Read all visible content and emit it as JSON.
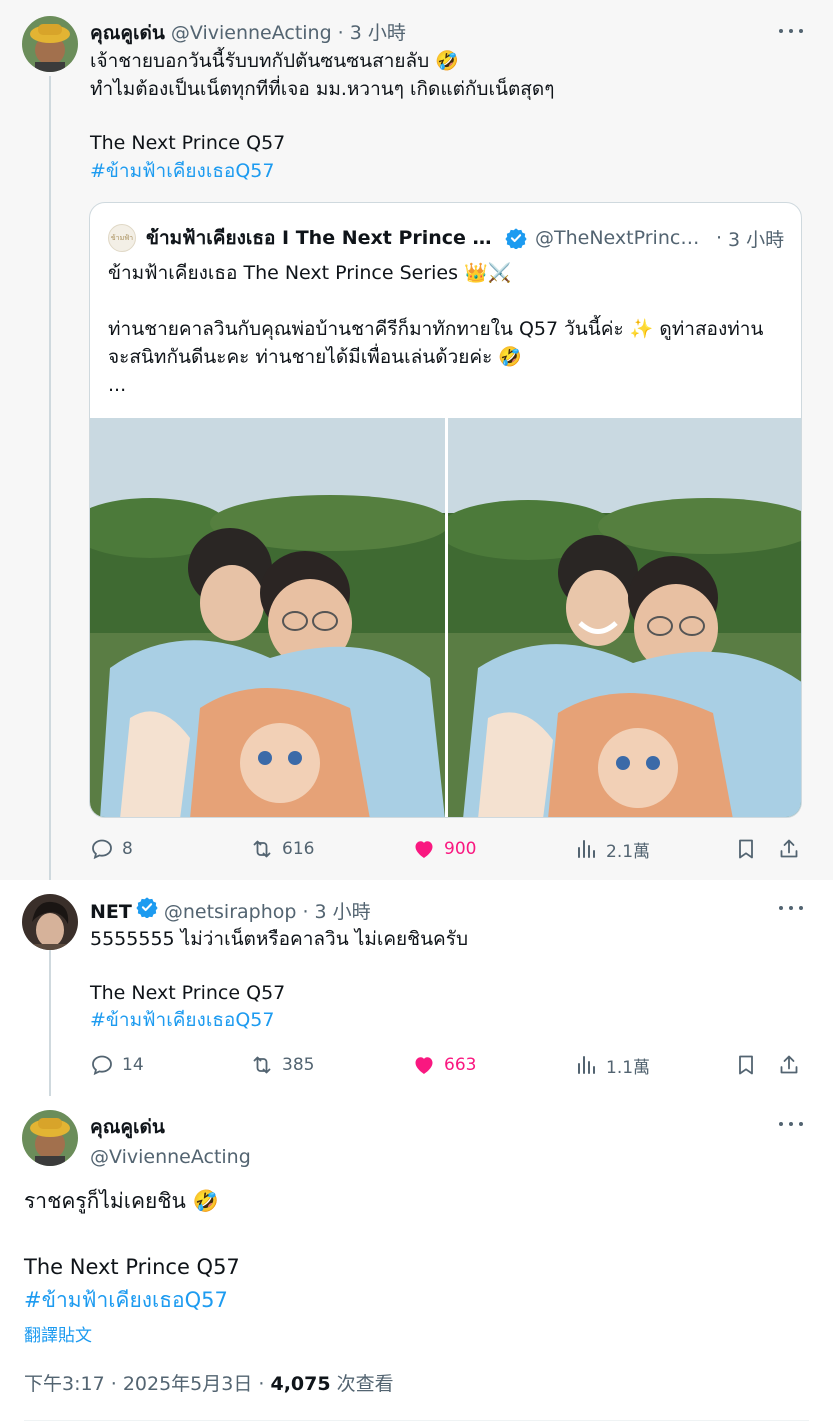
{
  "tweet1": {
    "name": "คุณคูเด่น",
    "handle": "@VivienneActing",
    "separator": "·",
    "time": "3 小時",
    "line1": "เจ้าชายบอกวันนี้รับบทกัปตันซนซนสายลับ 🤣",
    "line2": "ทำไมต้องเป็นเน็ตทุกทีที่เจอ มม.หวานๆ เกิดแต่กับเน็ตสุดๆ",
    "line3": "The Next Prince Q57",
    "hashtag": "#ข้ามฟ้าเคียงเธอQ57",
    "quote": {
      "avatar_text": "ข้ามฟ้า",
      "name": "ข้ามฟ้าเคียงเธอ I The Next Prince Series",
      "handle": "@TheNextPrinceSeries",
      "separator": "·",
      "time": "3 小時",
      "line1": "ข้ามฟ้าเคียงเธอ The Next Prince Series 👑⚔️",
      "line2": "ท่านชายคาลวินกับคุณพ่อบ้านชาคีรีก็มาทักทายใน Q57 วันนี้ค่ะ ✨ ดูท่าสองท่าน",
      "line3": "จะสนิทกันดีนะคะ ท่านชายได้มีเพื่อนเล่นด้วยค่ะ 🤣",
      "line4": "..."
    },
    "replies": "8",
    "reposts": "616",
    "likes": "900",
    "views": "2.1萬"
  },
  "tweet2": {
    "name": "NET",
    "handle": "@netsiraphop",
    "separator": "·",
    "time": "3 小時",
    "line1": "5555555 ไม่ว่าเน็ตหรือคาลวิน ไม่เคยชินครับ",
    "line2": "The Next Prince Q57",
    "hashtag": "#ข้ามฟ้าเคียงเธอQ57",
    "replies": "14",
    "reposts": "385",
    "likes": "663",
    "views": "1.1萬"
  },
  "tweet3": {
    "name": "คุณคูเด่น",
    "handle": "@VivienneActing",
    "line1": "ราชครูก็ไม่เคยชิน 🤣",
    "line2": "The Next Prince Q57",
    "hashtag": "#ข้ามฟ้าเคียงเธอQ57",
    "translate": "翻譯貼文",
    "time": "下午3:17",
    "separator": "·",
    "date": "2025年5月3日",
    "separator2": "·",
    "views_count": "4,075",
    "views_label": "次查看"
  },
  "colors": {
    "accent": "#1d9bf0",
    "like": "#f91880",
    "muted": "#536471",
    "verified": "#1d9bf0"
  }
}
